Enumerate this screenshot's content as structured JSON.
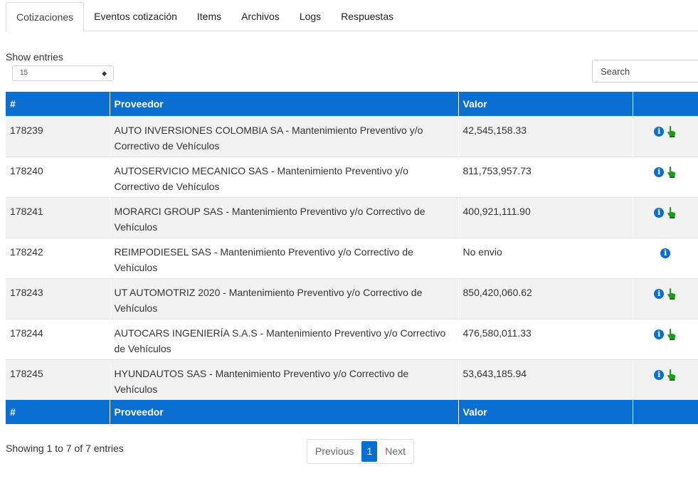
{
  "tabs": [
    {
      "label": "Cotizaciones",
      "active": true
    },
    {
      "label": "Eventos cotización",
      "active": false
    },
    {
      "label": "Items",
      "active": false
    },
    {
      "label": "Archivos",
      "active": false
    },
    {
      "label": "Logs",
      "active": false
    },
    {
      "label": "Respuestas",
      "active": false
    }
  ],
  "length": {
    "label": "Show entries",
    "value": "15"
  },
  "search": {
    "placeholder": "Search"
  },
  "table": {
    "headers": [
      "#",
      "Proveedor",
      "Valor",
      ""
    ],
    "rows": [
      {
        "id": "178239",
        "proveedor": "AUTO INVERSIONES COLOMBIA SA - Mantenimiento Preventivo y/o Correctivo de Vehículos",
        "valor": "42,545,158.33",
        "actions": [
          "info-icon",
          "hand-pointer-icon"
        ]
      },
      {
        "id": "178240",
        "proveedor": "AUTOSERVICIO MECANICO SAS - Mantenimiento Preventivo y/o Correctivo de Vehículos",
        "valor": "811,753,957.73",
        "actions": [
          "info-icon",
          "hand-pointer-icon"
        ]
      },
      {
        "id": "178241",
        "proveedor": "MORARCI GROUP SAS - Mantenimiento Preventivo y/o Correctivo de Vehículos",
        "valor": "400,921,111.90",
        "actions": [
          "info-icon",
          "hand-pointer-icon"
        ]
      },
      {
        "id": "178242",
        "proveedor": "REIMPODIESEL SAS  - Mantenimiento Preventivo y/o Correctivo de Vehículos",
        "valor": "No envio",
        "actions": [
          "info-icon"
        ]
      },
      {
        "id": "178243",
        "proveedor": "UT AUTOMOTRIZ 2020 - Mantenimiento Preventivo y/o Correctivo de Vehículos",
        "valor": "850,420,060.62",
        "actions": [
          "info-icon",
          "hand-pointer-icon"
        ]
      },
      {
        "id": "178244",
        "proveedor": "AUTOCARS INGENIERÍA S.A.S - Mantenimiento Preventivo y/o Correctivo de Vehículos",
        "valor": "476,580,011.33",
        "actions": [
          "info-icon",
          "hand-pointer-icon"
        ]
      },
      {
        "id": "178245",
        "proveedor": "HYUNDAUTOS SAS - Mantenimiento Preventivo y/o Correctivo de Vehículos",
        "valor": "53,643,185.94",
        "actions": [
          "info-icon",
          "hand-pointer-icon"
        ]
      }
    ]
  },
  "footer": {
    "info": "Showing 1 to 7 of 7 entries",
    "previous": "Previous",
    "current_page": "1",
    "next": "Next"
  },
  "colors": {
    "accent": "#0b6fd1",
    "action_green": "#1e9a1e"
  }
}
